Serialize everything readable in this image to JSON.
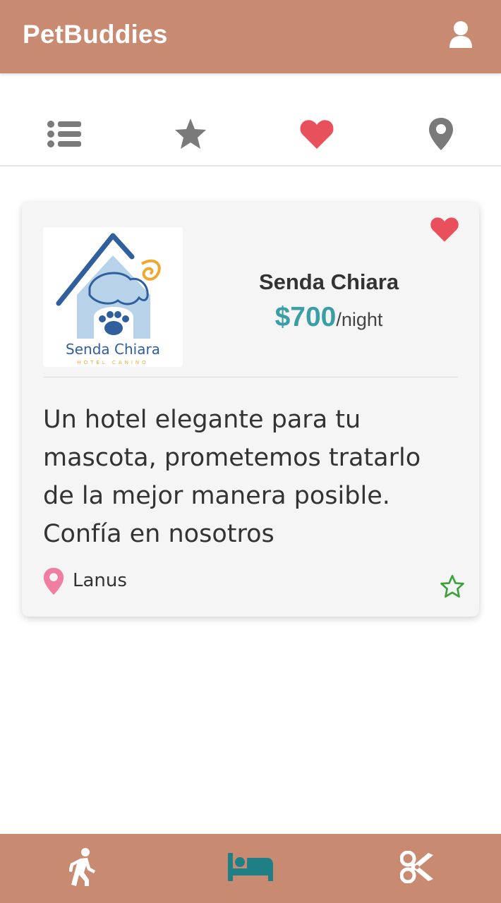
{
  "header": {
    "app_title": "PetBuddies",
    "user_icon": "user-icon"
  },
  "tabs": [
    {
      "icon": "list-icon",
      "active": false
    },
    {
      "icon": "star-icon",
      "active": false
    },
    {
      "icon": "heart-icon",
      "active": true
    },
    {
      "icon": "map-marker-icon",
      "active": false
    }
  ],
  "card": {
    "name": "Senda Chiara",
    "price": "$700",
    "per_unit": "/night",
    "description": "Un hotel elegante para tu mascota, prometemos tratarlo de la mejor manera posible. Confía en nosotros",
    "location": "Lanus",
    "favorite": true,
    "logo": {
      "title": "Senda Chiara",
      "subtitle": "HOTEL CANINO"
    }
  },
  "bottom_nav": [
    {
      "icon": "walking-icon",
      "active": false
    },
    {
      "icon": "bed-icon",
      "active": true
    },
    {
      "icon": "scissors-icon",
      "active": false
    }
  ],
  "colors": {
    "brand": "#c98a72",
    "accent": "#3a9ea6",
    "heart": "#e8505b",
    "pin": "#ef7ea0",
    "star_outline": "#3aa03a",
    "icon_gray": "#7a7a7a"
  }
}
